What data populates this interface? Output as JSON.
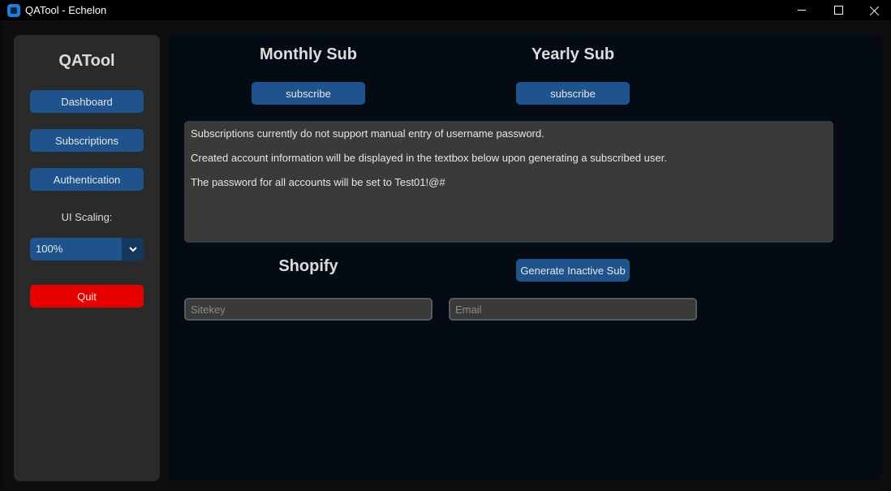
{
  "window": {
    "title": "QATool - Echelon",
    "controls": {
      "minimize": "minimize-icon",
      "maximize": "maximize-icon",
      "close": "close-icon"
    }
  },
  "sidebar": {
    "title": "QATool",
    "buttons": {
      "dashboard": "Dashboard",
      "subscriptions": "Subscriptions",
      "authentication": "Authentication"
    },
    "scaling_label": "UI Scaling:",
    "scaling_value": "100%",
    "quit": "Quit"
  },
  "main": {
    "monthly": {
      "heading": "Monthly Sub",
      "button": "subscribe"
    },
    "yearly": {
      "heading": "Yearly Sub",
      "button": "subscribe"
    },
    "info_lines": [
      "Subscriptions currently do not support manual entry of username password.",
      "Created account information will be displayed in the textbox below upon generating a subscribed user.",
      "The password for all accounts will be set to Test01!@#"
    ],
    "shopify": {
      "heading": "Shopify",
      "generate_button": "Generate Inactive Sub",
      "sitekey_placeholder": "Sitekey",
      "email_placeholder": "Email"
    }
  },
  "colors": {
    "accent": "#1f538d",
    "quit": "#e60000",
    "main_bg": "#050b14",
    "sidebar_bg": "#2a2a2b"
  }
}
